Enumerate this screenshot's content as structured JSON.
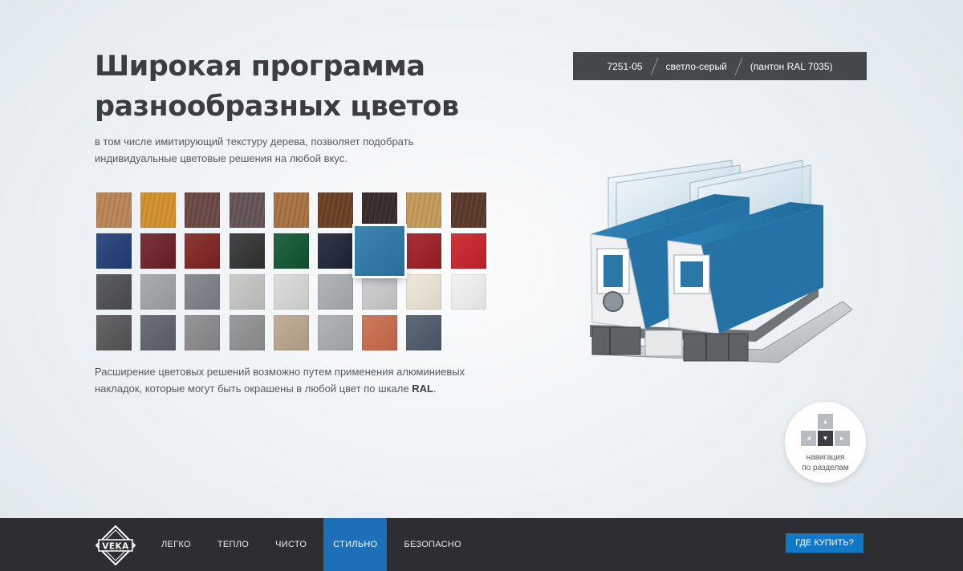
{
  "hero": {
    "title_line1": "Широкая программа",
    "title_line2": "разнообразных цветов",
    "subtitle": "в том числе имитирующий текстуру дерева, позволяет подобрать индивидуальные цветовые решения на любой вкус.",
    "footnote_text": "Расширение цветовых решений возможно путем применения алюминиевых накладок, которые могут быть окрашены в любой цвет по шкале ",
    "footnote_bold": "RAL",
    "footnote_end": "."
  },
  "selected_color": {
    "code": "7251-05",
    "name": "светло-серый",
    "pantone": "(пантон RAL 7035)"
  },
  "swatches": [
    [
      {
        "c": "#b98457",
        "wood": true
      },
      {
        "c": "#d2902e",
        "wood": true
      },
      {
        "c": "#6b4a45",
        "wood": true
      },
      {
        "c": "#645457",
        "wood": true
      },
      {
        "c": "#a77244",
        "wood": true
      },
      {
        "c": "#6b4226",
        "wood": true
      },
      {
        "c": "#3b2c2c",
        "wood": true
      },
      {
        "c": "#c49a5a",
        "wood": true
      },
      {
        "c": "#5a3a2c",
        "wood": true
      }
    ],
    [
      {
        "c": "#1f3c78"
      },
      {
        "c": "#6c1e24"
      },
      {
        "c": "#7e2320"
      },
      {
        "c": "#2f3230"
      },
      {
        "c": "#0e5530"
      },
      {
        "c": "#1d2236"
      },
      {
        "c": "#2a77a8",
        "selected": true
      },
      {
        "c": "#9e1c22"
      },
      {
        "c": "#c8202a"
      }
    ],
    [
      {
        "c": "#4b4d50"
      },
      {
        "c": "#9fa3a6"
      },
      {
        "c": "#7b8188"
      },
      {
        "c": "#c3c6c3"
      },
      {
        "c": "#d7dad7"
      },
      {
        "c": "#a8adb1"
      },
      {
        "c": "#c9cbcc"
      },
      {
        "c": "#eee6d6"
      },
      {
        "c": "#f2f2f0"
      }
    ],
    [
      {
        "c": "#555457"
      },
      {
        "c": "#5b606b"
      },
      {
        "c": "#8a898c"
      },
      {
        "c": "#8e9092"
      },
      {
        "c": "#b9a78d"
      },
      {
        "c": "#a9acb0"
      },
      {
        "c": "#c96a4c"
      },
      {
        "c": "#4d5a68"
      }
    ]
  ],
  "nav": {
    "label_line1": "навигация",
    "label_line2": "по разделам",
    "up": "▲",
    "down": "▼",
    "left": "◄",
    "right": "►"
  },
  "footer": {
    "logo_text": "VEKA",
    "menu": [
      "ЛЕГКО",
      "ТЕПЛО",
      "ЧИСТО",
      "СТИЛЬНО",
      "БЕЗОПАСНО"
    ],
    "active_index": 3,
    "buy_label": "ГДЕ КУПИТЬ?"
  },
  "colors": {
    "accent": "#1d6fb8",
    "footer_bg": "#2c2e31",
    "title": "#3b3d40",
    "profile_blue": "#2a77a8"
  }
}
